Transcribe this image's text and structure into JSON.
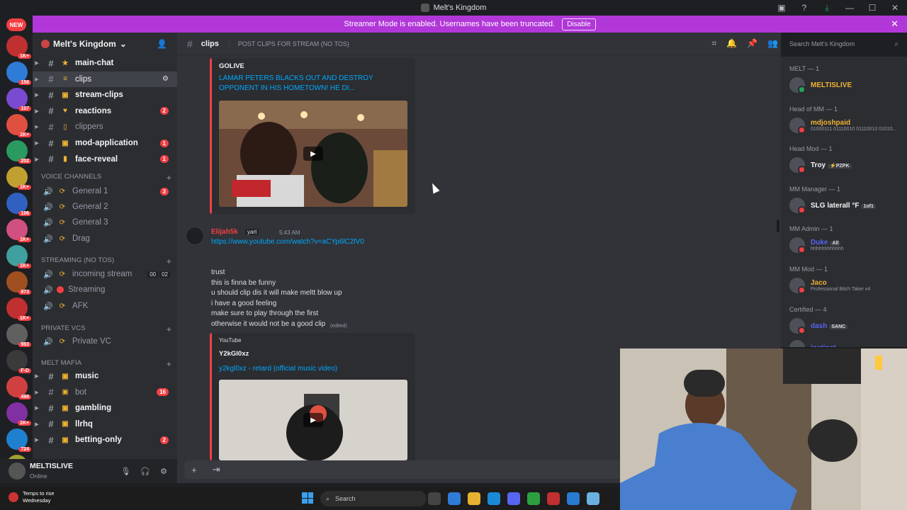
{
  "window": {
    "title": "Melt's Kingdom"
  },
  "notice": {
    "text": "Streamer Mode is enabled. Usernames have been truncated.",
    "button": "Disable"
  },
  "servers": {
    "new_label": "NEW",
    "badges": [
      "1K+",
      "158",
      "107",
      "1K+",
      "202",
      "1K+",
      "106",
      "1K+",
      "1K+",
      "973",
      "1K+",
      "983",
      "F-D",
      "498",
      "1K+",
      "724",
      "1K+"
    ]
  },
  "guild": {
    "name": "Melt's Kingdom"
  },
  "channels": {
    "text1": [
      {
        "label": "main-chat",
        "deco": "★",
        "badge": ""
      },
      {
        "label": "clips",
        "deco": "≡",
        "badge": ""
      },
      {
        "label": "stream-clips",
        "deco": "▣",
        "badge": ""
      },
      {
        "label": "reactions",
        "deco": "♥",
        "badge": "2"
      },
      {
        "label": "clippers",
        "deco": "▯",
        "badge": ""
      },
      {
        "label": "mod-application",
        "deco": "▣",
        "badge": "1"
      },
      {
        "label": "face-reveal",
        "deco": "▮",
        "badge": "1"
      }
    ],
    "voice_category": "VOICE CHANNELS",
    "voice": [
      "General 1",
      "General 2",
      "General 3",
      "Drag"
    ],
    "voice_badge": "3",
    "streaming_category": "STREAMING (NO TOS)",
    "streaming": [
      "incoming stream",
      "Streaming",
      "AFK"
    ],
    "stream_counts": [
      "00",
      "02"
    ],
    "private_category": "PRIVATE VCS",
    "private": [
      "Private VC"
    ],
    "mafia_category": "MELT MAFIA",
    "mafia": [
      {
        "label": "music",
        "badge": ""
      },
      {
        "label": "bot",
        "badge": "16"
      },
      {
        "label": "gambling",
        "badge": ""
      },
      {
        "label": "llrhq",
        "badge": ""
      },
      {
        "label": "betting-only",
        "badge": "2"
      }
    ]
  },
  "user": {
    "name": "MELTISLIVE",
    "status": "Online"
  },
  "header": {
    "channel": "clips",
    "topic": "POST CLIPS FOR STREAM (NO TOS)"
  },
  "search": {
    "placeholder": "Search Melt's Kingdom"
  },
  "messages": {
    "embed1": {
      "provider": "GOLIVE",
      "title1": "LAMAR PETERS BLACKS OUT AND DESTROY",
      "title2": "OPPONENT IN HIS HOMETOWN! HE DI..."
    },
    "author2": "Elijah5k",
    "tag2": "yart",
    "time2": "5:43 AM",
    "link2": "https://www.youtube.com/watch?v=aCYp6lC2lV0",
    "lines": [
      "trust",
      "this is finna be funny",
      "u should clip dis it will make meltt blow up",
      "i have a good feeling",
      "make sure to play through the first",
      "otherwise it would not be a good clip"
    ],
    "edited": "(edited)",
    "embed2": {
      "provider": "YouTube",
      "author": "Y2kGl0xz",
      "title": "y2kgl0xz - retard (official music video)"
    }
  },
  "members": {
    "groups": [
      {
        "role": "MELT — 1",
        "name": "MELTISLIVE",
        "status": "",
        "tag": "",
        "color": "#f0b232",
        "online": true
      },
      {
        "role": "Head of MM — 1",
        "name": "mdjoshpaid",
        "status": "01000111 01110010 01110010 01010...",
        "tag": "",
        "color": "#f0b232",
        "online": false
      },
      {
        "role": "Head Mod — 1",
        "name": "Troy",
        "status": "",
        "tag": "⚡PZPK",
        "color": "#f2f3f5",
        "online": false
      },
      {
        "role": "MM Manager — 1",
        "name": "SLG laterall °F",
        "status": "",
        "tag": "1of1",
        "color": "#f2f3f5",
        "online": false
      },
      {
        "role": "MM Admin — 1",
        "name": "Duke",
        "status": "hhhhhhhhhhhh",
        "tag": "All",
        "color": "#5865f2",
        "online": false
      },
      {
        "role": "MM Mod — 1",
        "name": "Jaco",
        "status": "Professional Bitch Taker x4",
        "tag": "",
        "color": "#f0b232",
        "online": false
      },
      {
        "role": "Certified — 4",
        "name": "dash",
        "status": "",
        "tag": "SANC",
        "color": "#5865f2",
        "online": false
      }
    ],
    "extra": "instinct"
  },
  "taskbar": {
    "weather1": "Temps to rise",
    "weather2": "Wednesday",
    "search": "Search"
  },
  "colors": {
    "notice": "#b137d8",
    "link": "#00a8fc",
    "danger": "#f23f43",
    "gold": "#f0b232"
  }
}
